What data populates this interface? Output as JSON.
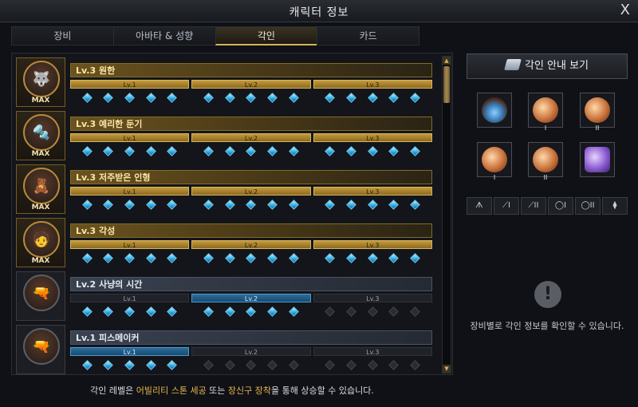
{
  "window": {
    "title": "캐릭터 정보",
    "close": "X"
  },
  "tabs": [
    {
      "label": "장비",
      "active": false
    },
    {
      "label": "아바타 & 성향",
      "active": false
    },
    {
      "label": "각인",
      "active": true
    },
    {
      "label": "카드",
      "active": false
    }
  ],
  "engravings": [
    {
      "name": "Lv.3 원한",
      "max": true,
      "max_label": "MAX",
      "icon": "🐺",
      "level": 3,
      "levels": [
        "Lv.1",
        "Lv.2",
        "Lv.3"
      ]
    },
    {
      "name": "Lv.3 예리한 둔기",
      "max": true,
      "max_label": "MAX",
      "icon": "🔩",
      "level": 3,
      "levels": [
        "Lv.1",
        "Lv.2",
        "Lv.3"
      ]
    },
    {
      "name": "Lv.3 저주받은 인형",
      "max": true,
      "max_label": "MAX",
      "icon": "🧸",
      "level": 3,
      "levels": [
        "Lv.1",
        "Lv.2",
        "Lv.3"
      ]
    },
    {
      "name": "Lv.3 각성",
      "max": true,
      "max_label": "MAX",
      "icon": "🧑",
      "level": 3,
      "levels": [
        "Lv.1",
        "Lv.2",
        "Lv.3"
      ]
    },
    {
      "name": "Lv.2 사냥의 시간",
      "max": false,
      "max_label": "",
      "icon": "🔫",
      "level": 2,
      "levels": [
        "Lv.1",
        "Lv.2",
        "Lv.3"
      ]
    },
    {
      "name": "Lv.1 피스메이커",
      "max": false,
      "max_label": "",
      "icon": "🔫",
      "level": 1,
      "levels": [
        "Lv.1",
        "Lv.2",
        "Lv.3"
      ]
    }
  ],
  "footer": {
    "prefix": "각인 레벨은 ",
    "hl1": "어빌리티 스톤 세공",
    "mid": " 또는 ",
    "hl2": "장신구 장착",
    "suffix": "을 통해 상승할 수 있습니다."
  },
  "right_panel": {
    "guide_button": "각인 안내 보기",
    "equipment": [
      {
        "name": "necklace",
        "roman": ""
      },
      {
        "name": "earring-1",
        "roman": "I"
      },
      {
        "name": "earring-2",
        "roman": "II"
      },
      {
        "name": "ring-1",
        "roman": "I"
      },
      {
        "name": "ring-2",
        "roman": "II"
      },
      {
        "name": "ability-stone",
        "roman": ""
      }
    ],
    "filters": [
      "ᗑ",
      "⟋I",
      "⟋II",
      "◯I",
      "◯II",
      "⧫"
    ],
    "notice_icon": "!",
    "notice_text": "장비별로 각인 정보를 확인할 수 있습니다."
  },
  "colors": {
    "accent_gold": "#d6b25a",
    "gem_blue": "#2aa7e0",
    "current_blue": "#2c6d9c"
  }
}
